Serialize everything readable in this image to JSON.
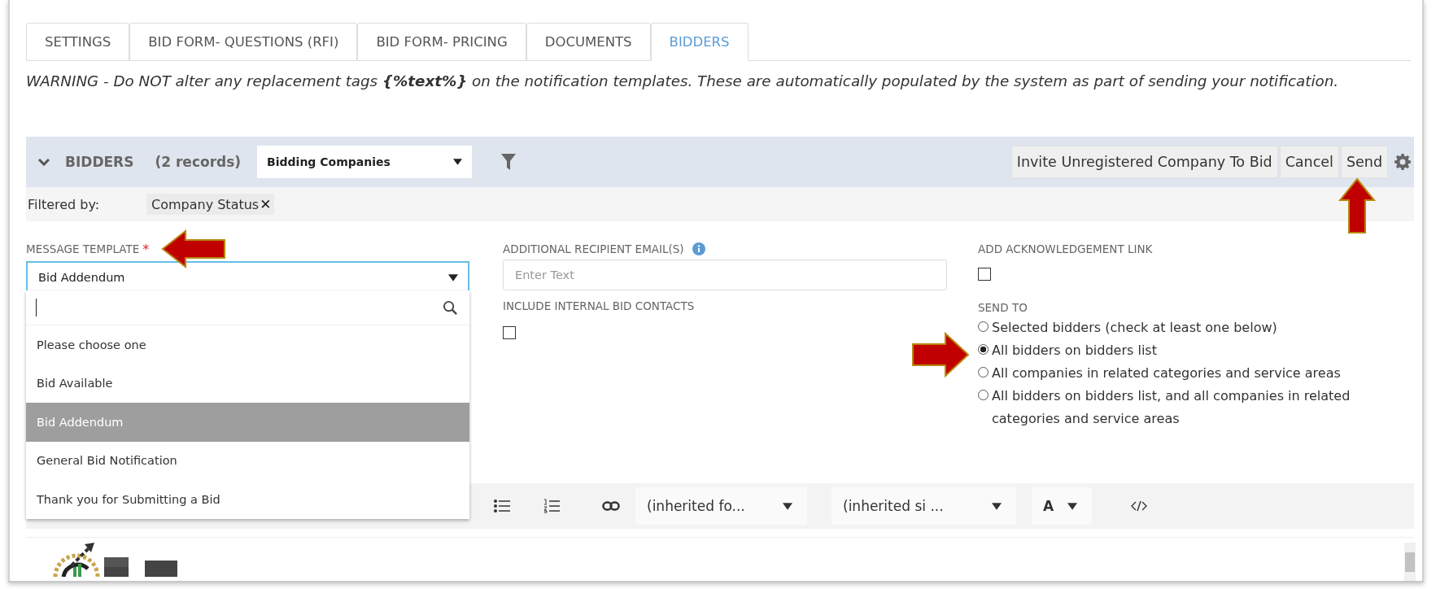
{
  "tabs": [
    {
      "label": "SETTINGS",
      "selected": false
    },
    {
      "label": "BID FORM- QUESTIONS (RFI)",
      "selected": false
    },
    {
      "label": "BID FORM- PRICING",
      "selected": false
    },
    {
      "label": "DOCUMENTS",
      "selected": false
    },
    {
      "label": "BIDDERS",
      "selected": true
    }
  ],
  "warning": "WARNING - Do NOT alter any replacement tags **{%text%}** on the notification templates. These are automatically populated by the system as part of sending your notification.",
  "panel": {
    "title": "BIDDERS",
    "count": "(2 records)",
    "expanded": true,
    "view_select": {
      "value": "Bidding Companies"
    },
    "buttons": [
      "Invite Unregistered Company To Bid",
      "Cancel",
      "Send"
    ]
  },
  "filter": {
    "label": "Filtered by:",
    "chips": [
      {
        "label": "Company Status",
        "remove": "✕"
      }
    ]
  },
  "message_template": {
    "label": "MESSAGE TEMPLATE",
    "required_mark": "*",
    "value": "Bid Addendum",
    "expanded": true,
    "options": [
      {
        "label": "Please choose one",
        "selected": false
      },
      {
        "label": "Bid Available",
        "selected": false
      },
      {
        "label": "Bid Addendum",
        "selected": true
      },
      {
        "label": "General Bid Notification",
        "selected": false
      },
      {
        "label": "Thank you for Submitting a Bid",
        "selected": false
      }
    ]
  },
  "additional_recipients": {
    "label": "ADDITIONAL RECIPIENT EMAIL(S)",
    "placeholder": "Enter Text"
  },
  "include_internal": {
    "label": "INCLUDE INTERNAL BID CONTACTS",
    "checked": false
  },
  "acknowledgement": {
    "label": "ADD ACKNOWLEDGEMENT LINK",
    "checked": false
  },
  "send_to": {
    "label": "SEND TO",
    "options": [
      {
        "label": "Selected bidders (check at least one below)",
        "selected": false
      },
      {
        "label": "All bidders on bidders list",
        "selected": true
      },
      {
        "label": "All companies in related categories and service areas",
        "selected": false
      },
      {
        "label": "All bidders on bidders list, and all companies in related categories and service areas",
        "selected": false
      }
    ]
  },
  "editor": {
    "toolbar": {
      "font": "(inherited fo...",
      "size": "(inherited si ...",
      "color_label": "A"
    }
  }
}
